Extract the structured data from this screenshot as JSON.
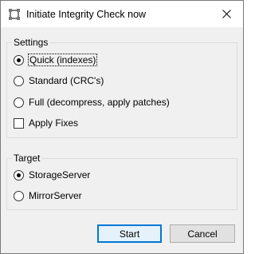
{
  "window": {
    "title": "Initiate Integrity Check now"
  },
  "settings": {
    "legend": "Settings",
    "options": [
      {
        "label": "Quick (indexes)",
        "checked": true
      },
      {
        "label": "Standard (CRC's)",
        "checked": false
      },
      {
        "label": "Full (decompress, apply patches)",
        "checked": false
      }
    ],
    "apply_fixes": {
      "label": "Apply Fixes",
      "checked": false
    }
  },
  "target": {
    "legend": "Target",
    "options": [
      {
        "label": "StorageServer",
        "checked": true
      },
      {
        "label": "MirrorServer",
        "checked": false
      }
    ]
  },
  "buttons": {
    "start": "Start",
    "cancel": "Cancel"
  },
  "colors": {
    "default_button_border": "#0078d7",
    "dialog_bg": "#f0f0f0"
  },
  "icons": {
    "app": "integrity-check-icon",
    "close": "close-icon"
  }
}
